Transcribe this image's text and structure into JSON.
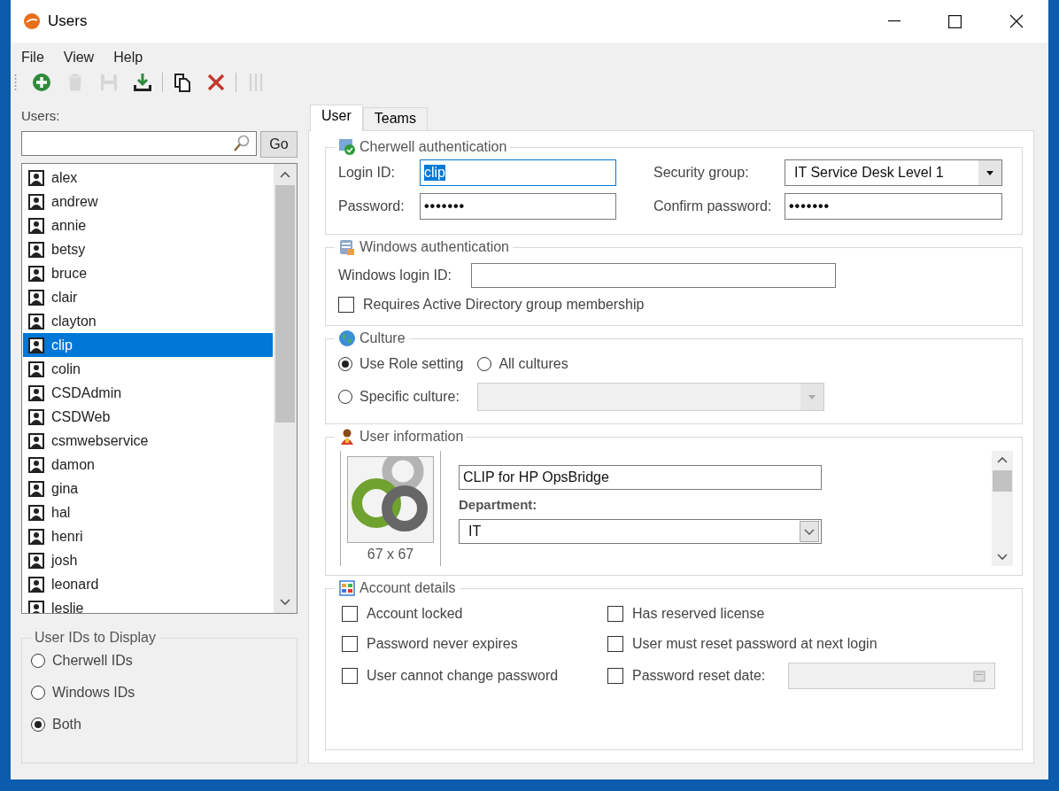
{
  "window": {
    "title": "Users"
  },
  "menu": [
    "File",
    "View",
    "Help"
  ],
  "toolbar": [
    {
      "kind": "add",
      "disabled": false
    },
    {
      "kind": "delete",
      "disabled": true
    },
    {
      "kind": "save",
      "disabled": true
    },
    {
      "kind": "import",
      "disabled": false
    },
    {
      "kind": "separator"
    },
    {
      "kind": "copy",
      "disabled": false
    },
    {
      "kind": "cancel",
      "disabled": false
    },
    {
      "kind": "separator"
    },
    {
      "kind": "columns",
      "disabled": true
    }
  ],
  "users_panel": {
    "label": "Users:",
    "go_button": "Go",
    "users": [
      {
        "name": "alex",
        "selected": false
      },
      {
        "name": "andrew",
        "selected": false
      },
      {
        "name": "annie",
        "selected": false
      },
      {
        "name": "betsy",
        "selected": false
      },
      {
        "name": "bruce",
        "selected": false
      },
      {
        "name": "clair",
        "selected": false
      },
      {
        "name": "clayton",
        "selected": false
      },
      {
        "name": "clip",
        "selected": true
      },
      {
        "name": "colin",
        "selected": false
      },
      {
        "name": "CSDAdmin",
        "selected": false
      },
      {
        "name": "CSDWeb",
        "selected": false
      },
      {
        "name": "csmwebservice",
        "selected": false
      },
      {
        "name": "damon",
        "selected": false
      },
      {
        "name": "gina",
        "selected": false
      },
      {
        "name": "hal",
        "selected": false
      },
      {
        "name": "henri",
        "selected": false
      },
      {
        "name": "josh",
        "selected": false
      },
      {
        "name": "leonard",
        "selected": false
      },
      {
        "name": "leslie",
        "selected": false
      }
    ],
    "display_options": {
      "title": "User IDs to Display",
      "options": [
        {
          "label": "Cherwell IDs",
          "selected": false
        },
        {
          "label": "Windows IDs",
          "selected": false
        },
        {
          "label": "Both",
          "selected": true
        }
      ]
    }
  },
  "tabs": [
    {
      "label": "User",
      "selected": true
    },
    {
      "label": "Teams",
      "selected": false
    }
  ],
  "cherwell_auth": {
    "title": "Cherwell authentication",
    "login_id": {
      "label": "Login ID:",
      "value": "clip"
    },
    "security_group": {
      "label": "Security group:",
      "value": "IT Service Desk Level 1"
    },
    "password": {
      "label": "Password:",
      "value": "•••••••"
    },
    "confirm_password": {
      "label": "Confirm password:",
      "value": "•••••••"
    }
  },
  "windows_auth": {
    "title": "Windows authentication",
    "login_label": "Windows login ID:",
    "ad_checkbox": {
      "label": "Requires Active Directory group membership",
      "checked": false
    }
  },
  "culture": {
    "title": "Culture",
    "options": [
      {
        "label": "Use Role setting",
        "selected": true
      },
      {
        "label": "All cultures",
        "selected": false
      },
      {
        "label": "Specific culture:",
        "selected": false
      }
    ]
  },
  "user_information": {
    "title": "User information",
    "picture_caption": "67 x 67",
    "full_name": "CLIP for HP OpsBridge",
    "department_label": "Department:",
    "department": "IT"
  },
  "account_details": {
    "title": "Account details",
    "checkboxes": [
      {
        "label": "Account locked",
        "checked": false
      },
      {
        "label": "Has reserved license",
        "checked": false
      },
      {
        "label": "Password never expires",
        "checked": false
      },
      {
        "label": "User must reset password at next login",
        "checked": false
      },
      {
        "label": "User cannot change password",
        "checked": false
      },
      {
        "label": "Password reset date:",
        "checked": false
      }
    ]
  }
}
